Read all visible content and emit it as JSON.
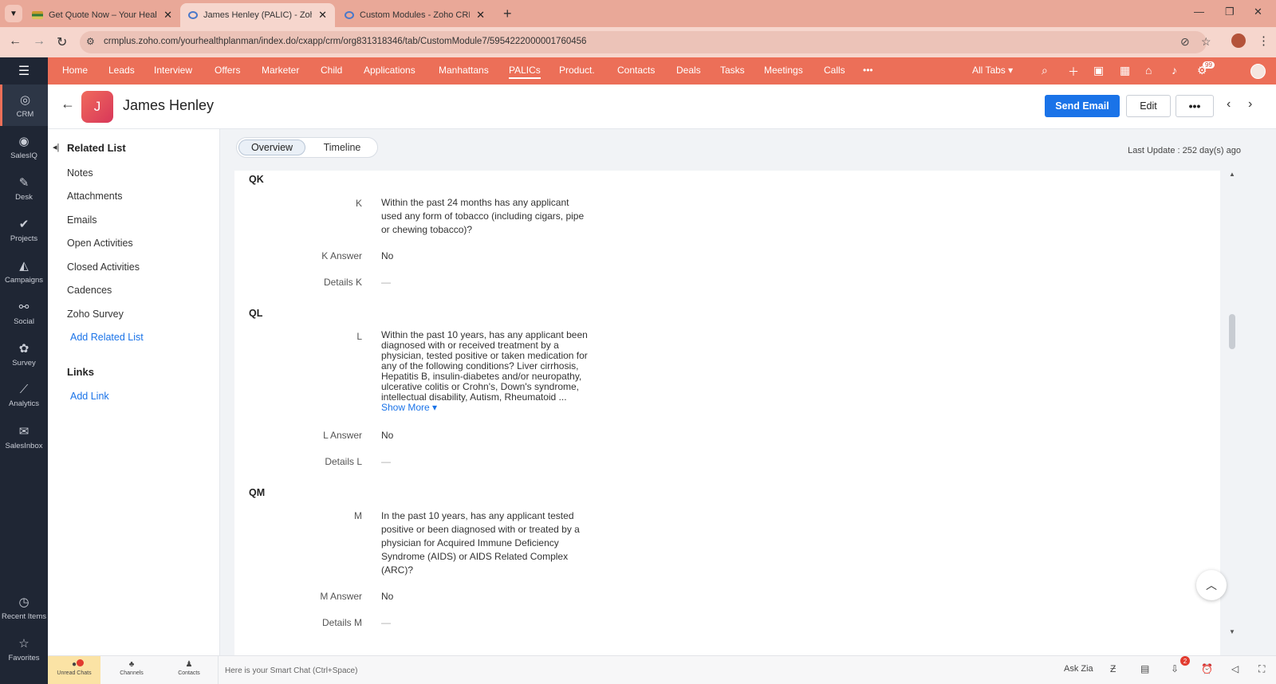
{
  "browser": {
    "tabs": [
      {
        "title": "Get Quote Now – Your Health P",
        "favicon": "quote-favicon"
      },
      {
        "title": "James Henley (PALIC) - Zoho CR",
        "favicon": "zoho-favicon"
      },
      {
        "title": "Custom Modules - Zoho CRM",
        "favicon": "zoho-favicon"
      }
    ],
    "url": "crmplus.zoho.com/yourhealthplanman/index.do/cxapp/crm/org831318346/tab/CustomModule7/5954222000001760456"
  },
  "nav": {
    "items": [
      "Home",
      "Leads",
      "Interview",
      "Offers",
      "Marketer",
      "Child",
      "Applications",
      "Manhattans",
      "PALICs",
      "Product.",
      "Contacts",
      "Deals",
      "Tasks",
      "Meetings",
      "Calls"
    ],
    "more": "•••",
    "all_tabs": "All Tabs ▾",
    "notification_count": "99",
    "accent_color": "#ec6f58"
  },
  "rail": {
    "items": [
      {
        "label": "CRM",
        "icon": "crm-icon"
      },
      {
        "label": "SalesIQ",
        "icon": "salesiq-icon"
      },
      {
        "label": "Desk",
        "icon": "desk-icon"
      },
      {
        "label": "Projects",
        "icon": "projects-icon"
      },
      {
        "label": "Campaigns",
        "icon": "campaigns-icon"
      },
      {
        "label": "Social",
        "icon": "social-icon"
      },
      {
        "label": "Survey",
        "icon": "survey-icon"
      },
      {
        "label": "Analytics",
        "icon": "analytics-icon"
      },
      {
        "label": "SalesInbox",
        "icon": "salesinbox-icon"
      }
    ],
    "bottom": [
      {
        "label": "Recent Items",
        "icon": "clock-icon"
      },
      {
        "label": "Favorites",
        "icon": "star-icon"
      }
    ]
  },
  "record": {
    "avatar_letter": "J",
    "name": "James Henley",
    "send_email": "Send Email",
    "edit": "Edit",
    "more": "•••"
  },
  "related": {
    "heading": "Related List",
    "items": [
      "Notes",
      "Attachments",
      "Emails",
      "Open Activities",
      "Closed Activities",
      "Cadences",
      "Zoho Survey"
    ],
    "add_related": "Add Related List",
    "links_heading": "Links",
    "add_link": "Add Link"
  },
  "main": {
    "tabs": [
      "Overview",
      "Timeline"
    ],
    "last_update": "Last Update : 252 day(s) ago"
  },
  "sections": [
    {
      "title": "QK",
      "fields": [
        {
          "label": "K",
          "value": "Within the past 24 months has any applicant used any form of tobacco (including cigars, pipe or chewing tobacco)?"
        },
        {
          "label": "K Answer",
          "value": "No"
        },
        {
          "label": "Details K",
          "value": "—"
        }
      ]
    },
    {
      "title": "QL",
      "fields": [
        {
          "label": "L",
          "value": "Within the past 10 years, has any applicant been diagnosed with or received treatment by a physician, tested positive or taken medication for any of the following conditions? Liver cirrhosis, Hepatitis B, insulin-diabetes and/or neuropathy, ulcerative colitis or Crohn's, Down's syndrome, intellectual disability, Autism, Rheumatoid ...",
          "show_more": "Show More ▾"
        },
        {
          "label": "L Answer",
          "value": "No"
        },
        {
          "label": "Details L",
          "value": "—"
        }
      ]
    },
    {
      "title": "QM",
      "fields": [
        {
          "label": "M",
          "value": "In the past 10 years, has any applicant tested positive or been diagnosed with or treated by a physician for Acquired Immune Deficiency Syndrome (AIDS) or AIDS Related Complex (ARC)?"
        },
        {
          "label": "M Answer",
          "value": "No"
        },
        {
          "label": "Details M",
          "value": "—"
        }
      ]
    }
  ],
  "bottombar": {
    "tabs": [
      "Unread Chats",
      "Channels",
      "Contacts"
    ],
    "smart_chat": "Here is your Smart Chat (Ctrl+Space)",
    "ask_zia": "Ask Zia",
    "alert_count": "2"
  }
}
